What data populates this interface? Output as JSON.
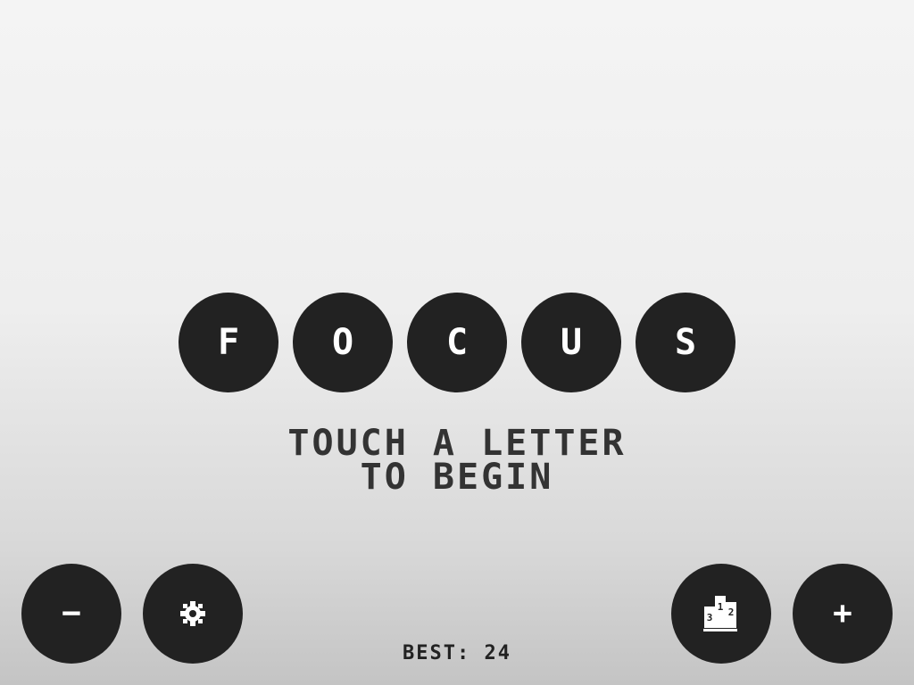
{
  "letters": [
    "F",
    "O",
    "C",
    "U",
    "S"
  ],
  "instruction": {
    "line1": "TOUCH A LETTER",
    "line2": "TO BEGIN"
  },
  "controls": {
    "minus_label": "−",
    "plus_label": "+",
    "settings_icon": "gear-icon",
    "leaderboard_icon": "podium-icon",
    "podium_places": [
      "3",
      "1",
      "2"
    ]
  },
  "best": {
    "label": "BEST:",
    "value": "24"
  },
  "colors": {
    "button": "#222222",
    "text": "#333333",
    "background_top": "#f4f4f4",
    "background_bottom": "#c4c4c4"
  }
}
